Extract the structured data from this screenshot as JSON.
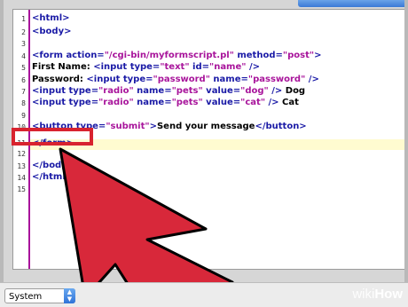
{
  "line_numbers": [
    "1",
    "2",
    "3",
    "4",
    "5",
    "6",
    "7",
    "8",
    "9",
    "10",
    "11",
    "12",
    "13",
    "14",
    "15"
  ],
  "code": {
    "l1": "<html>",
    "l2": "<body>",
    "l4_tag": "<form ",
    "l4_attr1": "action=",
    "l4_val1": "\"/cgi-bin/myformscript.pl\"",
    "l4_attr2": " method=",
    "l4_val2": "\"post\"",
    "l4_end": ">",
    "l5_text": "First Name: ",
    "l5_tag": "<input ",
    "l5_attr1": "type=",
    "l5_val1": "\"text\"",
    "l5_attr2": " id=",
    "l5_val2": "\"name\"",
    "l5_end": " />",
    "l6_text": "Password: ",
    "l6_tag": "<input ",
    "l6_attr1": "type=",
    "l6_val1": "\"password\"",
    "l6_attr2": " name=",
    "l6_val2": "\"password\"",
    "l6_end": " />",
    "l7_tag": "<input ",
    "l7_attr1": "type=",
    "l7_val1": "\"radio\"",
    "l7_attr2": " name=",
    "l7_val2": "\"pets\"",
    "l7_attr3": " value=",
    "l7_val3": "\"dog\"",
    "l7_end": " />",
    "l7_text": " Dog",
    "l8_tag": "<input ",
    "l8_attr1": "type=",
    "l8_val1": "\"radio\"",
    "l8_attr2": " name=",
    "l8_val2": "\"pets\"",
    "l8_attr3": " value=",
    "l8_val3": "\"cat\"",
    "l8_end": " />",
    "l8_text": " Cat",
    "l10_tag": "<button ",
    "l10_attr1": "type=",
    "l10_val1": "\"submit\"",
    "l10_end": ">",
    "l10_text": "Send your message",
    "l10_close": "</button>",
    "l11": "</form>",
    "l13": "</body>",
    "l14": "</html>"
  },
  "statusbar": {
    "syntax_select": "System"
  },
  "watermark": {
    "wiki": "wiki",
    "how": "How"
  },
  "colors": {
    "tag": "#1a1aa6",
    "value": "#a8149b",
    "highlight": "#d8232f",
    "arrow": "#d8283a"
  }
}
